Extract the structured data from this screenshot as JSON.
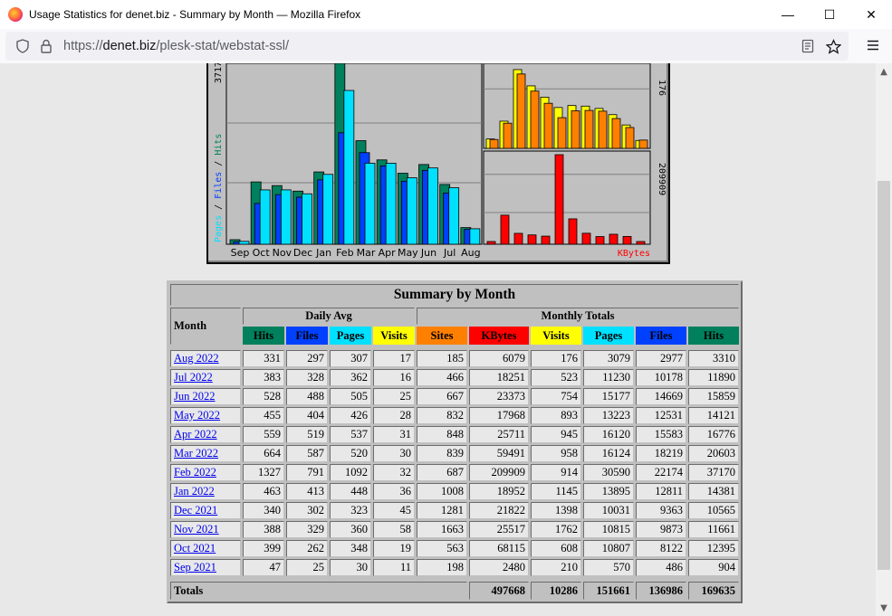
{
  "window": {
    "title": "Usage Statistics for denet.biz - Summary by Month — Mozilla Firefox",
    "minimize": "—",
    "maximize": "☐",
    "close": "✕"
  },
  "nav": {
    "url_prefix": "https://",
    "url_host": "denet.biz",
    "url_path": "/plesk-stat/webstat-ssl/"
  },
  "chart_data": [
    {
      "type": "bar",
      "title": "",
      "categories": [
        "Sep",
        "Oct",
        "Nov",
        "Dec",
        "Jan",
        "Feb",
        "Mar",
        "Apr",
        "May",
        "Jun",
        "Jul",
        "Aug"
      ],
      "series": [
        {
          "name": "Hits",
          "color": "#00805c",
          "values": [
            904,
            12395,
            11661,
            10565,
            14381,
            37170,
            20603,
            16776,
            14121,
            15859,
            11890,
            3310
          ]
        },
        {
          "name": "Files",
          "color": "#0040ff",
          "values": [
            486,
            8122,
            9873,
            9363,
            12811,
            22174,
            18219,
            15583,
            12531,
            14669,
            10178,
            2977
          ]
        },
        {
          "name": "Pages",
          "color": "#00e0ff",
          "values": [
            570,
            10807,
            10815,
            10031,
            13895,
            30590,
            16124,
            16120,
            13223,
            15177,
            11230,
            3079
          ]
        }
      ],
      "ylabel": "Pages / Files / Hits",
      "ymax_label": "3717"
    },
    {
      "type": "bar",
      "series": [
        {
          "name": "Sites",
          "color": "#ff8000",
          "values": [
            198,
            563,
            1663,
            1281,
            1008,
            687,
            839,
            848,
            832,
            667,
            466,
            185
          ]
        },
        {
          "name": "Visits",
          "color": "#ffff00",
          "values": [
            210,
            608,
            1762,
            1398,
            1145,
            914,
            958,
            945,
            893,
            754,
            523,
            176
          ]
        }
      ],
      "ymax_label": "176"
    },
    {
      "type": "bar",
      "series": [
        {
          "name": "KBytes",
          "color": "#ff0000",
          "values": [
            2480,
            68115,
            25517,
            21822,
            18952,
            209909,
            59491,
            25711,
            17968,
            23373,
            18251,
            6079
          ]
        }
      ],
      "ymax_label": "209909",
      "xlabel": "KBytes"
    }
  ],
  "table": {
    "caption": "Summary by Month",
    "month_header": "Month",
    "daily_avg": "Daily Avg",
    "monthly_totals": "Monthly Totals",
    "columns": [
      {
        "label": "Hits",
        "bg": "#00805c",
        "fg": "#000"
      },
      {
        "label": "Files",
        "bg": "#0040ff",
        "fg": "#000"
      },
      {
        "label": "Pages",
        "bg": "#00e0ff",
        "fg": "#000"
      },
      {
        "label": "Visits",
        "bg": "#ffff00",
        "fg": "#000"
      },
      {
        "label": "Sites",
        "bg": "#ff8000",
        "fg": "#000"
      },
      {
        "label": "KBytes",
        "bg": "#ff0000",
        "fg": "#000"
      },
      {
        "label": "Visits",
        "bg": "#ffff00",
        "fg": "#000"
      },
      {
        "label": "Pages",
        "bg": "#00e0ff",
        "fg": "#000"
      },
      {
        "label": "Files",
        "bg": "#0040ff",
        "fg": "#000"
      },
      {
        "label": "Hits",
        "bg": "#00805c",
        "fg": "#000"
      }
    ],
    "rows": [
      {
        "month": "Aug 2022",
        "v": [
          "331",
          "297",
          "307",
          "17",
          "185",
          "6079",
          "176",
          "3079",
          "2977",
          "3310"
        ]
      },
      {
        "month": "Jul 2022",
        "v": [
          "383",
          "328",
          "362",
          "16",
          "466",
          "18251",
          "523",
          "11230",
          "10178",
          "11890"
        ]
      },
      {
        "month": "Jun 2022",
        "v": [
          "528",
          "488",
          "505",
          "25",
          "667",
          "23373",
          "754",
          "15177",
          "14669",
          "15859"
        ]
      },
      {
        "month": "May 2022",
        "v": [
          "455",
          "404",
          "426",
          "28",
          "832",
          "17968",
          "893",
          "13223",
          "12531",
          "14121"
        ]
      },
      {
        "month": "Apr 2022",
        "v": [
          "559",
          "519",
          "537",
          "31",
          "848",
          "25711",
          "945",
          "16120",
          "15583",
          "16776"
        ]
      },
      {
        "month": "Mar 2022",
        "v": [
          "664",
          "587",
          "520",
          "30",
          "839",
          "59491",
          "958",
          "16124",
          "18219",
          "20603"
        ]
      },
      {
        "month": "Feb 2022",
        "v": [
          "1327",
          "791",
          "1092",
          "32",
          "687",
          "209909",
          "914",
          "30590",
          "22174",
          "37170"
        ]
      },
      {
        "month": "Jan 2022",
        "v": [
          "463",
          "413",
          "448",
          "36",
          "1008",
          "18952",
          "1145",
          "13895",
          "12811",
          "14381"
        ]
      },
      {
        "month": "Dec 2021",
        "v": [
          "340",
          "302",
          "323",
          "45",
          "1281",
          "21822",
          "1398",
          "10031",
          "9363",
          "10565"
        ]
      },
      {
        "month": "Nov 2021",
        "v": [
          "388",
          "329",
          "360",
          "58",
          "1663",
          "25517",
          "1762",
          "10815",
          "9873",
          "11661"
        ]
      },
      {
        "month": "Oct 2021",
        "v": [
          "399",
          "262",
          "348",
          "19",
          "563",
          "68115",
          "608",
          "10807",
          "8122",
          "12395"
        ]
      },
      {
        "month": "Sep 2021",
        "v": [
          "47",
          "25",
          "30",
          "11",
          "198",
          "2480",
          "210",
          "570",
          "486",
          "904"
        ]
      }
    ],
    "totals": {
      "label": "Totals",
      "v": [
        "497668",
        "10286",
        "151661",
        "136986",
        "169635"
      ]
    }
  }
}
